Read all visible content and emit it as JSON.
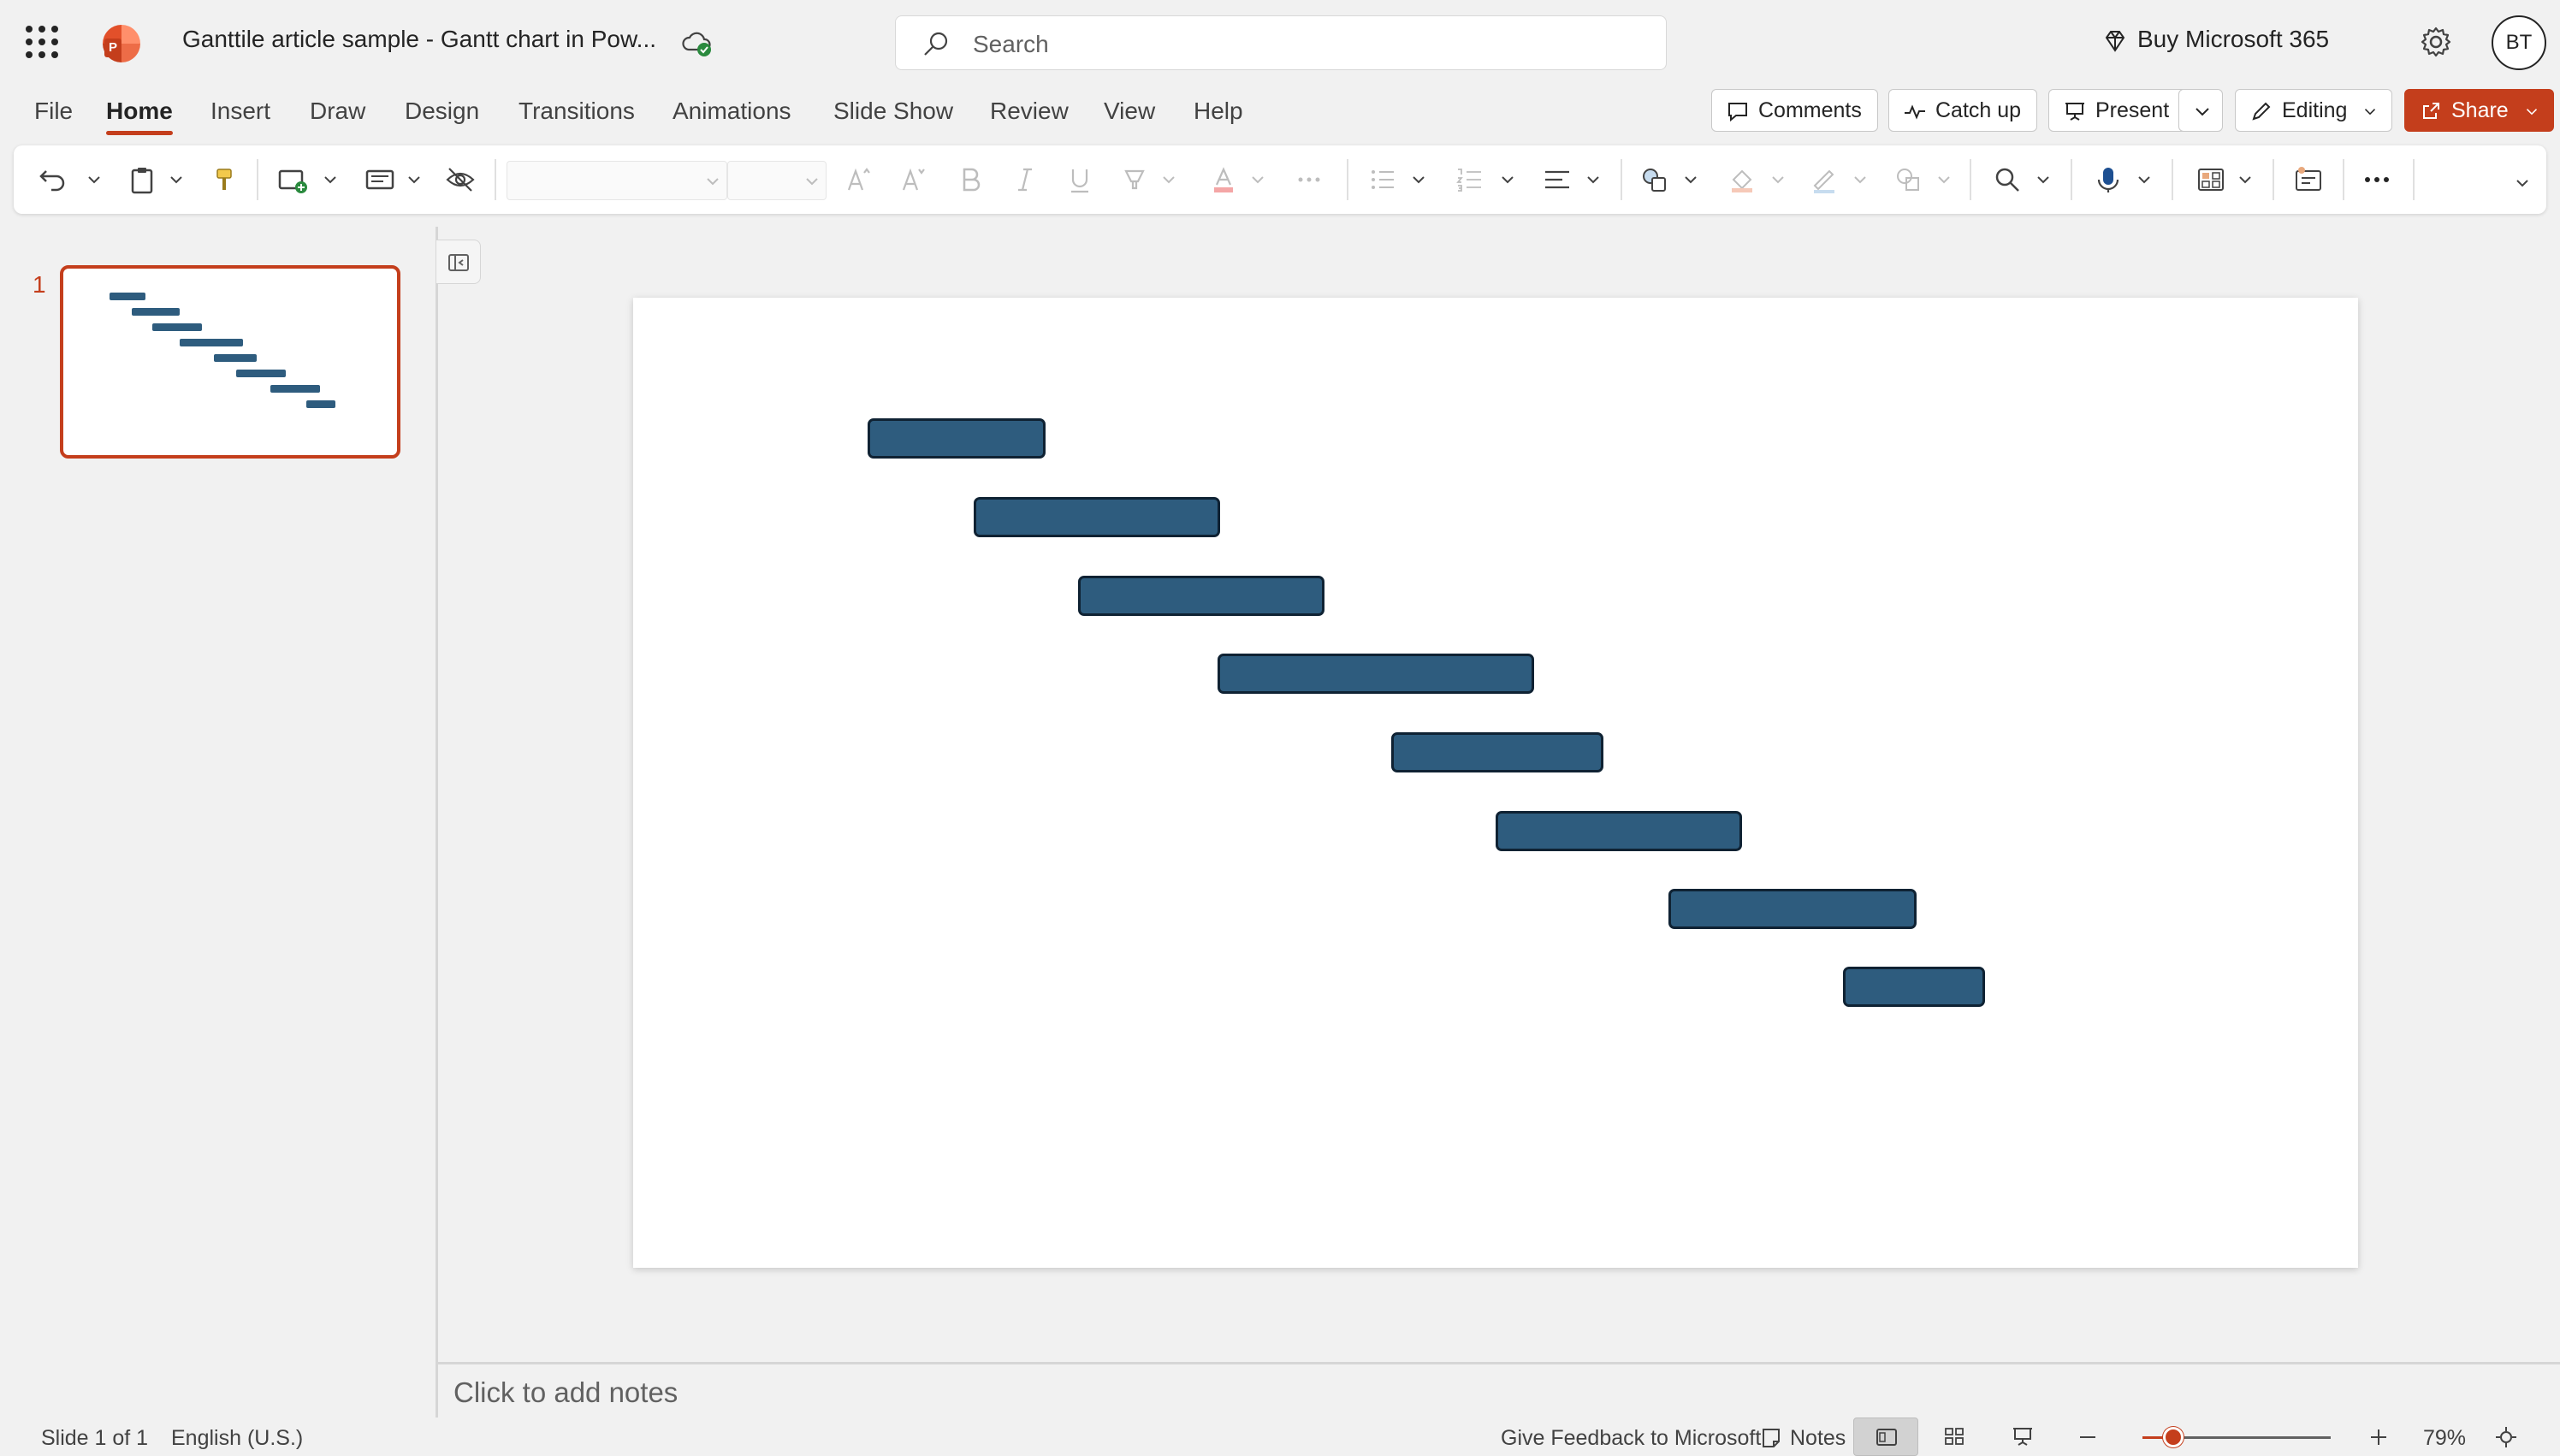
{
  "titlebar": {
    "doc_title": "Ganttile article sample - Gantt chart in Pow...",
    "search_placeholder": "Search",
    "buy_label": "Buy Microsoft 365",
    "avatar_initials": "BT"
  },
  "menu": {
    "tabs": [
      "File",
      "Home",
      "Insert",
      "Draw",
      "Design",
      "Transitions",
      "Animations",
      "Slide Show",
      "Review",
      "View",
      "Help"
    ],
    "active_tab": "Home",
    "actions": {
      "comments": "Comments",
      "catch_up": "Catch up",
      "present": "Present",
      "editing": "Editing",
      "share": "Share"
    }
  },
  "colors": {
    "accent": "#c43e1c",
    "gantt_bar_fill": "#2e5c7e",
    "gantt_bar_border": "#0f2233"
  },
  "thumbnails": [
    {
      "number": "1",
      "selected": true
    }
  ],
  "notes_placeholder": "Click to add notes",
  "status": {
    "slide_info": "Slide 1 of 1",
    "language": "English (U.S.)",
    "feedback": "Give Feedback to Microsoft",
    "notes_label": "Notes",
    "zoom": "79%"
  }
}
